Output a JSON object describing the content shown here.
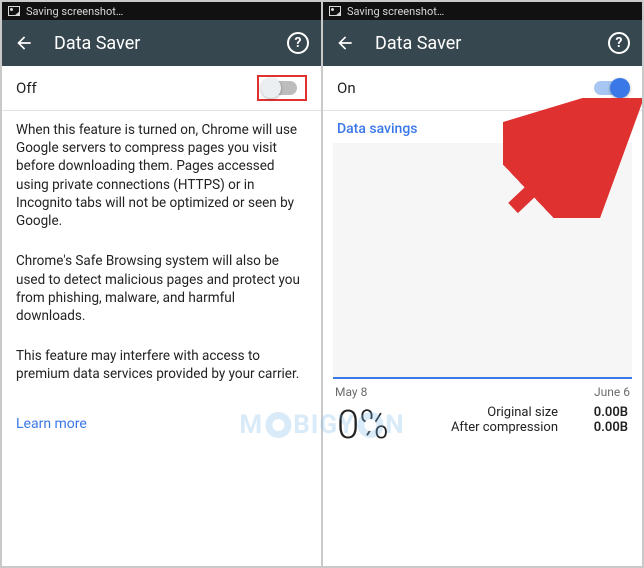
{
  "left": {
    "status": "Saving screenshot…",
    "title": "Data Saver",
    "help": "?",
    "toggle_label": "Off",
    "p1": "When this feature is turned on, Chrome will use Google servers to compress pages you visit before downloading them. Pages accessed using private connections (HTTPS) or in Incognito tabs will not be optimized or seen by Google.",
    "p2": "Chrome's Safe Browsing system will also be used to detect malicious pages and protect you from phishing, malware, and harmful downloads.",
    "p3": "This feature may interfere with access to premium data services provided by your carrier.",
    "learn_more": "Learn more"
  },
  "right": {
    "status": "Saving screenshot…",
    "title": "Data Saver",
    "help": "?",
    "toggle_label": "On",
    "section": "Data savings",
    "axis_start": "May 8",
    "axis_end": "June 6",
    "percent": "0%",
    "original_label": "Original size",
    "original_value": "0.00B",
    "compressed_label": "After compression",
    "compressed_value": "0.00B"
  },
  "watermark": "M BIGY N"
}
